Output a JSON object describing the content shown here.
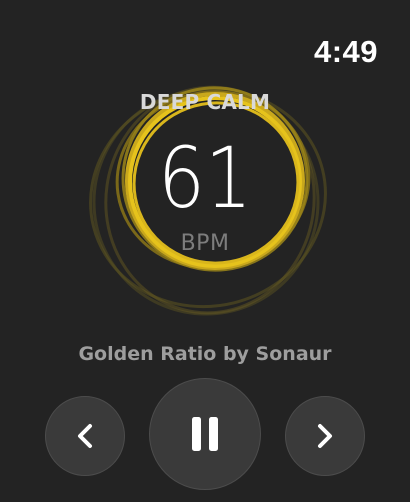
{
  "status_bar": {
    "time": "4:49"
  },
  "session": {
    "mode_title": "DEEP CALM",
    "bpm_value": "61",
    "bpm_unit": "BPM",
    "track": "Golden Ratio by Sonaur",
    "accent_color": "#e6c31c"
  },
  "controls": {
    "previous_icon": "chevron-left-icon",
    "play_pause_icon": "pause-icon",
    "next_icon": "chevron-right-icon"
  }
}
